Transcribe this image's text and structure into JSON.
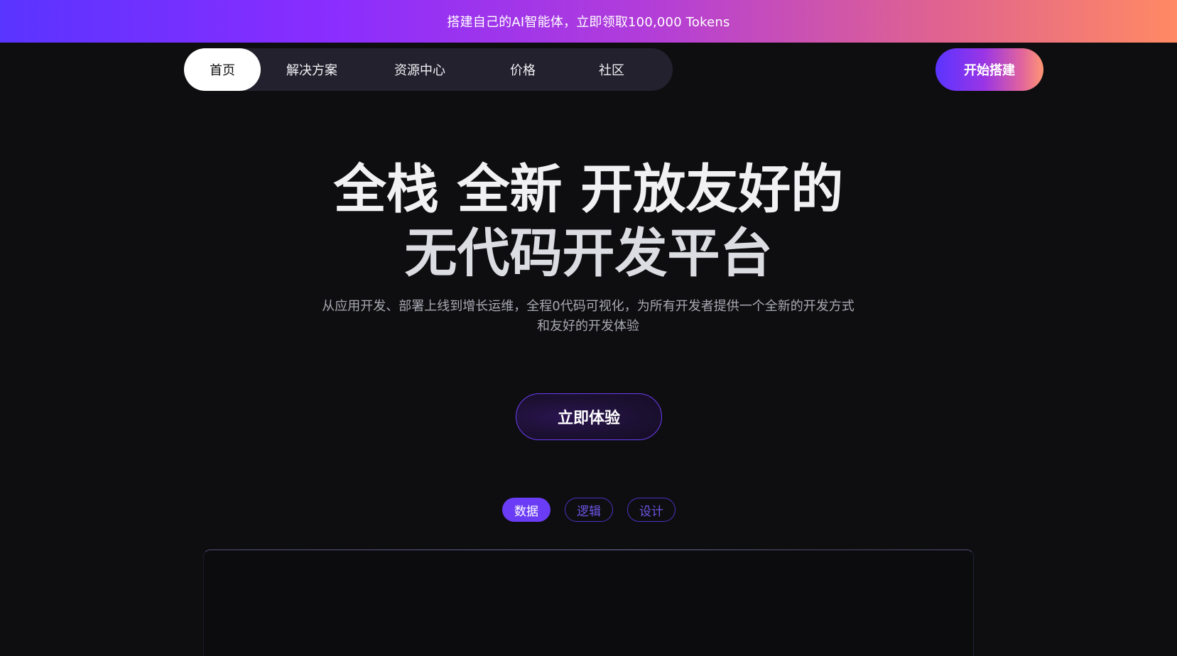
{
  "banner": {
    "text": "搭建自己的AI智能体，立即领取100,000 Tokens"
  },
  "nav": {
    "items": [
      {
        "label": "首页",
        "active": true
      },
      {
        "label": "解决方案",
        "active": false
      },
      {
        "label": "资源中心",
        "active": false
      },
      {
        "label": "价格",
        "active": false
      },
      {
        "label": "社区",
        "active": false
      }
    ],
    "cta_label": "开始搭建"
  },
  "hero": {
    "title_line1": "全栈 全新 开放友好的",
    "title_line2": "无代码开发平台",
    "subtitle_line1": "从应用开发、部署上线到增长运维，全程0代码可视化，为所有开发者提供一个全新的开发方式",
    "subtitle_line2": "和友好的开发体验",
    "cta_label": "立即体验"
  },
  "tabs": [
    {
      "label": "数据",
      "active": true
    },
    {
      "label": "逻辑",
      "active": false
    },
    {
      "label": "设计",
      "active": false
    }
  ],
  "colors": {
    "background": "#0e0e10",
    "accent_purple": "#6a3cf5",
    "gradient_start": "#5a34ff",
    "gradient_end": "#ff8a63"
  }
}
